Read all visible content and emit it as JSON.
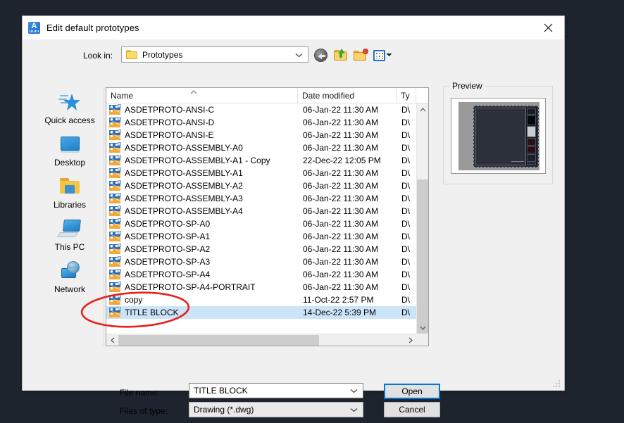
{
  "window": {
    "title": "Edit default prototypes",
    "app_icon": "autocad-icon",
    "close_label": "close-icon"
  },
  "toolbar": {
    "look_in_label": "Look in:",
    "look_in_value": "Prototypes",
    "buttons": [
      {
        "name": "back-button",
        "icon": "back-arrow-icon"
      },
      {
        "name": "up-one-level-button",
        "icon": "folder-up-icon"
      },
      {
        "name": "create-new-folder-button",
        "icon": "new-folder-icon"
      },
      {
        "name": "views-button",
        "icon": "views-grid-icon"
      }
    ]
  },
  "places": {
    "items": [
      {
        "label": "Quick access",
        "icon": "star-icon"
      },
      {
        "label": "Desktop",
        "icon": "monitor-icon"
      },
      {
        "label": "Libraries",
        "icon": "folder-library-icon"
      },
      {
        "label": "This PC",
        "icon": "computer-icon"
      },
      {
        "label": "Network",
        "icon": "network-globe-icon"
      }
    ]
  },
  "filelist": {
    "columns": [
      "Name",
      "Date modified",
      "Ty"
    ],
    "sort": {
      "column": "Name",
      "direction": "ascending"
    },
    "rows": [
      {
        "name": "ASDETPROTO-ANSI-C",
        "date": "06-Jan-22 11:30 AM",
        "type": "D\\",
        "selected": false
      },
      {
        "name": "ASDETPROTO-ANSI-D",
        "date": "06-Jan-22 11:30 AM",
        "type": "D\\",
        "selected": false
      },
      {
        "name": "ASDETPROTO-ANSI-E",
        "date": "06-Jan-22 11:30 AM",
        "type": "D\\",
        "selected": false
      },
      {
        "name": "ASDETPROTO-ASSEMBLY-A0",
        "date": "06-Jan-22 11:30 AM",
        "type": "D\\",
        "selected": false
      },
      {
        "name": "ASDETPROTO-ASSEMBLY-A1 - Copy",
        "date": "22-Dec-22 12:05 PM",
        "type": "D\\",
        "selected": false
      },
      {
        "name": "ASDETPROTO-ASSEMBLY-A1",
        "date": "06-Jan-22 11:30 AM",
        "type": "D\\",
        "selected": false
      },
      {
        "name": "ASDETPROTO-ASSEMBLY-A2",
        "date": "06-Jan-22 11:30 AM",
        "type": "D\\",
        "selected": false
      },
      {
        "name": "ASDETPROTO-ASSEMBLY-A3",
        "date": "06-Jan-22 11:30 AM",
        "type": "D\\",
        "selected": false
      },
      {
        "name": "ASDETPROTO-ASSEMBLY-A4",
        "date": "06-Jan-22 11:30 AM",
        "type": "D\\",
        "selected": false
      },
      {
        "name": "ASDETPROTO-SP-A0",
        "date": "06-Jan-22 11:30 AM",
        "type": "D\\",
        "selected": false
      },
      {
        "name": "ASDETPROTO-SP-A1",
        "date": "06-Jan-22 11:30 AM",
        "type": "D\\",
        "selected": false
      },
      {
        "name": "ASDETPROTO-SP-A2",
        "date": "06-Jan-22 11:30 AM",
        "type": "D\\",
        "selected": false
      },
      {
        "name": "ASDETPROTO-SP-A3",
        "date": "06-Jan-22 11:30 AM",
        "type": "D\\",
        "selected": false
      },
      {
        "name": "ASDETPROTO-SP-A4",
        "date": "06-Jan-22 11:30 AM",
        "type": "D\\",
        "selected": false
      },
      {
        "name": "ASDETPROTO-SP-A4-PORTRAIT",
        "date": "06-Jan-22 11:30 AM",
        "type": "D\\",
        "selected": false
      },
      {
        "name": "copy",
        "date": "11-Oct-22 2:57 PM",
        "type": "D\\",
        "selected": false
      },
      {
        "name": "TITLE BLOCK",
        "date": "14-Dec-22 5:39 PM",
        "type": "D\\",
        "selected": true
      }
    ]
  },
  "preview": {
    "legend": "Preview"
  },
  "form": {
    "file_name_label": "File name:",
    "file_name_value": "TITLE BLOCK",
    "files_of_type_label": "Files of type:",
    "files_of_type_value": "Drawing (*.dwg)",
    "open_label": "Open",
    "cancel_label": "Cancel"
  },
  "annotation": {
    "shape": "red-ellipse",
    "color": "#e8201a",
    "target": "TITLE BLOCK"
  },
  "colors": {
    "desktop_background": "#1e242e",
    "dialog_background": "#f0f0f0",
    "selection_blue": "#cce4f7",
    "accent_blue": "#0078d7",
    "annotation_red": "#e8201a"
  }
}
